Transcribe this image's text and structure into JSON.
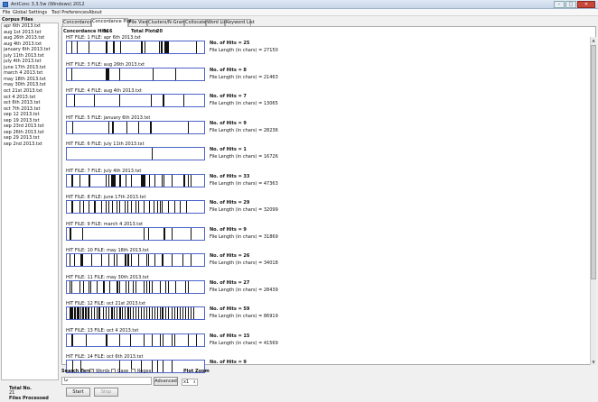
{
  "window": {
    "title": "AntConc 3.3.5w (Windows) 2012",
    "buttons": [
      "–",
      "□",
      "✕"
    ]
  },
  "menu": [
    "File",
    "Global Settings",
    "Tool Preferences",
    "About"
  ],
  "corpus": {
    "header": "Corpus Files",
    "files": [
      "apr 6th 2013.txt",
      "aug 1st 2013.txt",
      "aug 26th 2013.txt",
      "aug 4th 2013.txt",
      "january 6th 2013.txt",
      "july 11th 2013.txt",
      "july 4th 2013.txt",
      "june 17th 2013.txt",
      "march 4 2013.txt",
      "may 18th 2013.txt",
      "may 30th 2013.txt",
      "oct 21st 2013.txt",
      "oct 4 2013.txt",
      "oct 6th 2013.txt",
      "oct 7th 2013.txt",
      "sep 12 2013.txt",
      "sep 19 2013.txt",
      "sep 23rd 2013.txt",
      "sep 26th 2013.txt",
      "sep 29 2013.txt",
      "sep 2nd 2013.txt"
    ],
    "total_label": "Total No.",
    "total_value": "21",
    "files_processed_label": "Files Processed",
    "progress_fraction": 1.0
  },
  "tabs": [
    "Concordance",
    "Concordance Plot",
    "File View",
    "Clusters/N-Grams",
    "Collocates",
    "Word List",
    "Keyword List"
  ],
  "active_tab": 1,
  "stats": {
    "hits_label": "Concordance Hits",
    "hits_value": "316",
    "plots_label": "Total Plots",
    "plots_value": "20"
  },
  "hits_label": "No. of Hits =",
  "length_label": "File Length (in chars) =",
  "plots": [
    {
      "header": "HIT FILE: 1   FILE: apr 6th 2013.txt",
      "hits": "25",
      "length": "27150",
      "marks": [
        0.03,
        0.074,
        0.155,
        0.16,
        0.286,
        0.29,
        0.334,
        0.338,
        0.345,
        0.389,
        0.542,
        0.546,
        0.567,
        0.673,
        0.683,
        0.692,
        0.709,
        0.713,
        0.716,
        0.72,
        0.724,
        0.728,
        0.733,
        0.737,
        0.94
      ]
    },
    {
      "header": "HIT FILE: 3   FILE: aug 26th 2013.txt",
      "hits": "8",
      "length": "21463",
      "marks": [
        0.035,
        0.285,
        0.29,
        0.296,
        0.301,
        0.383,
        0.627,
        0.79
      ]
    },
    {
      "header": "HIT FILE: 4   FILE: aug 4th 2013.txt",
      "hits": "7",
      "length": "13065",
      "marks": [
        0.05,
        0.198,
        0.381,
        0.61,
        0.7,
        0.706,
        0.85
      ]
    },
    {
      "header": "HIT FILE: 5   FILE: january 6th 2013.txt",
      "hits": "9",
      "length": "28236",
      "marks": [
        0.04,
        0.301,
        0.332,
        0.338,
        0.435,
        0.52,
        0.603,
        0.612,
        0.88
      ]
    },
    {
      "header": "HIT FILE: 6   FILE: july 11th 2013.txt",
      "hits": "1",
      "length": "16726",
      "marks": [
        0.62
      ]
    },
    {
      "header": "HIT FILE: 7   FILE: july 4th 2013.txt",
      "hits": "33",
      "length": "47363",
      "marks": [
        0.03,
        0.035,
        0.04,
        0.09,
        0.16,
        0.165,
        0.28,
        0.3,
        0.32,
        0.326,
        0.335,
        0.342,
        0.346,
        0.38,
        0.385,
        0.43,
        0.47,
        0.54,
        0.545,
        0.551,
        0.555,
        0.56,
        0.566,
        0.6,
        0.64,
        0.69,
        0.703,
        0.707,
        0.76,
        0.85,
        0.858,
        0.88,
        0.9
      ]
    },
    {
      "header": "HIT FILE: 8   FILE: june 17th 2013.txt",
      "hits": "29",
      "length": "32099",
      "marks": [
        0.03,
        0.035,
        0.04,
        0.09,
        0.12,
        0.16,
        0.2,
        0.205,
        0.25,
        0.28,
        0.3,
        0.33,
        0.36,
        0.38,
        0.42,
        0.44,
        0.47,
        0.5,
        0.52,
        0.56,
        0.6,
        0.63,
        0.66,
        0.68,
        0.69,
        0.74,
        0.78,
        0.82,
        0.87
      ]
    },
    {
      "header": "HIT FILE: 9   FILE: march 4 2013.txt",
      "hits": "9",
      "length": "31869",
      "marks": [
        0.02,
        0.025,
        0.11,
        0.56,
        0.59,
        0.705,
        0.712,
        0.76,
        0.9
      ]
    },
    {
      "header": "HIT FILE: 10   FILE: may 18th 2013.txt",
      "hits": "26",
      "length": "34018",
      "marks": [
        0.02,
        0.05,
        0.1,
        0.105,
        0.11,
        0.18,
        0.25,
        0.3,
        0.305,
        0.34,
        0.345,
        0.36,
        0.42,
        0.43,
        0.44,
        0.45,
        0.47,
        0.52,
        0.58,
        0.59,
        0.64,
        0.69,
        0.7,
        0.76,
        0.84,
        0.9
      ]
    },
    {
      "header": "HIT FILE: 11   FILE: may 30th 2013.txt",
      "hits": "27",
      "length": "28439",
      "marks": [
        0.02,
        0.03,
        0.09,
        0.12,
        0.16,
        0.17,
        0.22,
        0.26,
        0.27,
        0.31,
        0.36,
        0.37,
        0.38,
        0.43,
        0.45,
        0.48,
        0.5,
        0.56,
        0.58,
        0.6,
        0.62,
        0.68,
        0.72,
        0.74,
        0.79,
        0.86,
        0.88
      ]
    },
    {
      "header": "HIT FILE: 12   FILE: oct 21st 2013.txt",
      "hits": "59",
      "length": "86919",
      "marks": [
        0.02,
        0.025,
        0.035,
        0.04,
        0.05,
        0.06,
        0.07,
        0.08,
        0.085,
        0.1,
        0.11,
        0.12,
        0.13,
        0.14,
        0.15,
        0.16,
        0.18,
        0.2,
        0.22,
        0.23,
        0.24,
        0.26,
        0.28,
        0.3,
        0.32,
        0.33,
        0.34,
        0.36,
        0.38,
        0.39,
        0.4,
        0.42,
        0.44,
        0.45,
        0.46,
        0.48,
        0.5,
        0.52,
        0.54,
        0.56,
        0.58,
        0.6,
        0.62,
        0.64,
        0.66,
        0.68,
        0.69,
        0.7,
        0.72,
        0.74,
        0.76,
        0.78,
        0.8,
        0.82,
        0.84,
        0.86,
        0.88,
        0.9,
        0.92
      ]
    },
    {
      "header": "HIT FILE: 13   FILE: oct 4 2013.txt",
      "hits": "15",
      "length": "41569",
      "marks": [
        0.03,
        0.04,
        0.14,
        0.28,
        0.29,
        0.38,
        0.46,
        0.56,
        0.62,
        0.68,
        0.7,
        0.76,
        0.78,
        0.88,
        0.94
      ]
    },
    {
      "header": "HIT FILE: 14   FILE: oct 6th 2013.txt",
      "hits": "9",
      "length": "",
      "marks": [
        0.04,
        0.1,
        0.38,
        0.47,
        0.54,
        0.62,
        0.66,
        0.7,
        0.76
      ]
    }
  ],
  "bottom": {
    "search_term_label": "Search Term",
    "words_label": "Words",
    "case_label": "Case",
    "regex_label": "Regex",
    "search_value": "جا",
    "advanced_label": "Advanced",
    "plot_zoom_label": "Plot Zoom",
    "zoom_value": "x1",
    "start_label": "Start",
    "stop_label": "Stop"
  }
}
